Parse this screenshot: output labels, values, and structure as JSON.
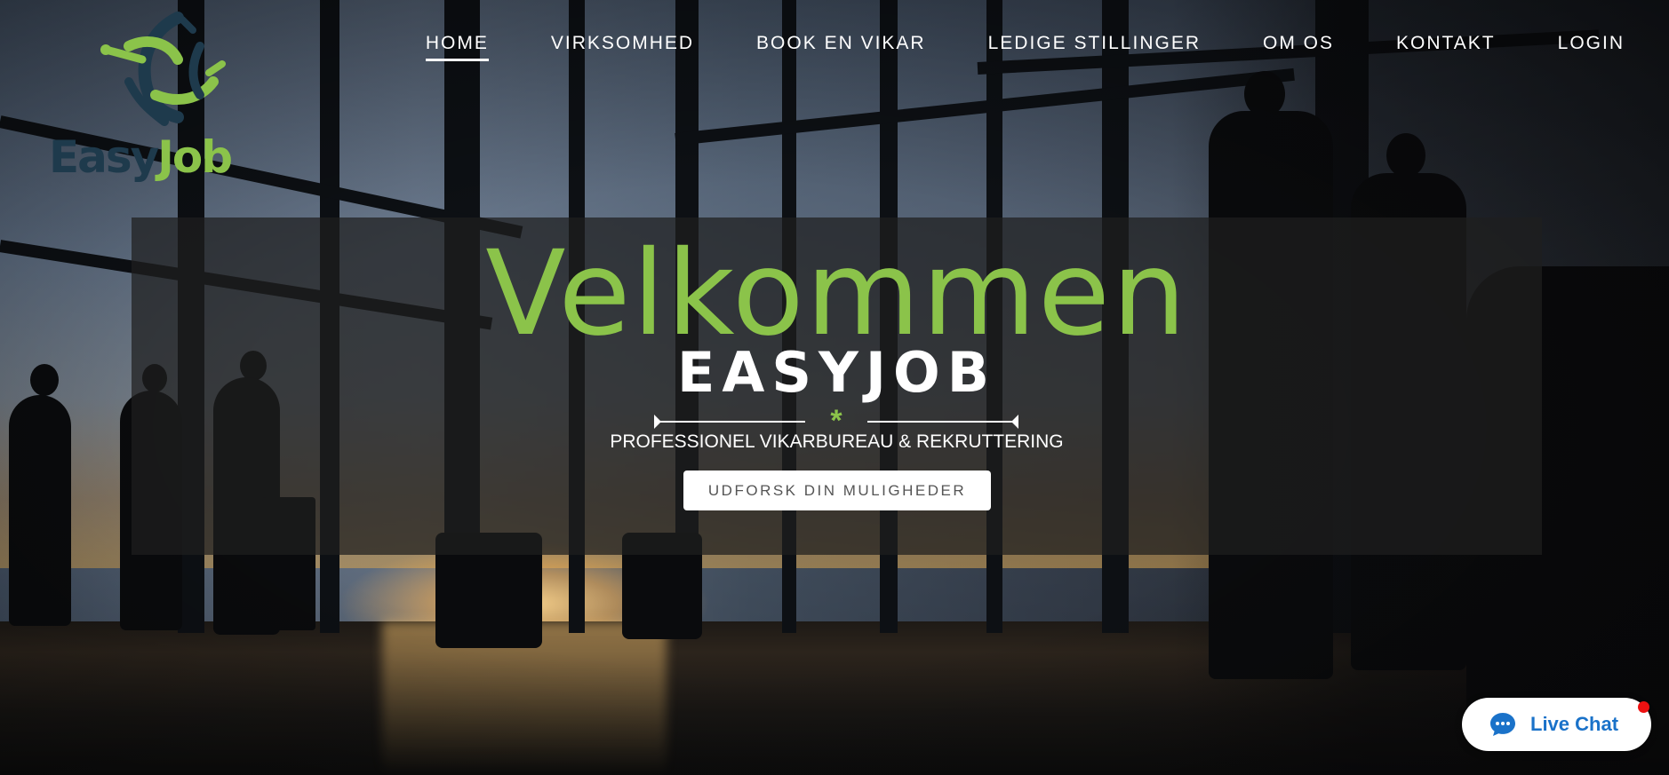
{
  "logo": {
    "text_easy": "Easy",
    "text_job": "Job",
    "icon": "easyjob-swirl-logo",
    "colors": {
      "navy": "#1e3a4c",
      "green": "#8bc34a"
    }
  },
  "nav": {
    "items": [
      {
        "label": "HOME",
        "active": true
      },
      {
        "label": "VIRKSOMHED",
        "active": false
      },
      {
        "label": "BOOK EN VIKAR",
        "active": false
      },
      {
        "label": "LEDIGE STILLINGER",
        "active": false
      },
      {
        "label": "OM OS",
        "active": false
      },
      {
        "label": "KONTAKT",
        "active": false
      },
      {
        "label": "LOGIN",
        "active": false
      }
    ]
  },
  "hero": {
    "heading": "Velkommen",
    "brand": "EASYJOB",
    "divider_symbol": "*",
    "tagline": "PROFESSIONEL VIKARBUREAU & REKRUTTERING",
    "cta_label": "UDFORSK DIN MULIGHEDER",
    "accent_color": "#8bc34a"
  },
  "chat": {
    "label": "Live Chat",
    "icon": "chat-bubble-icon",
    "color": "#1a72c9",
    "notification_color": "#ee1111"
  }
}
